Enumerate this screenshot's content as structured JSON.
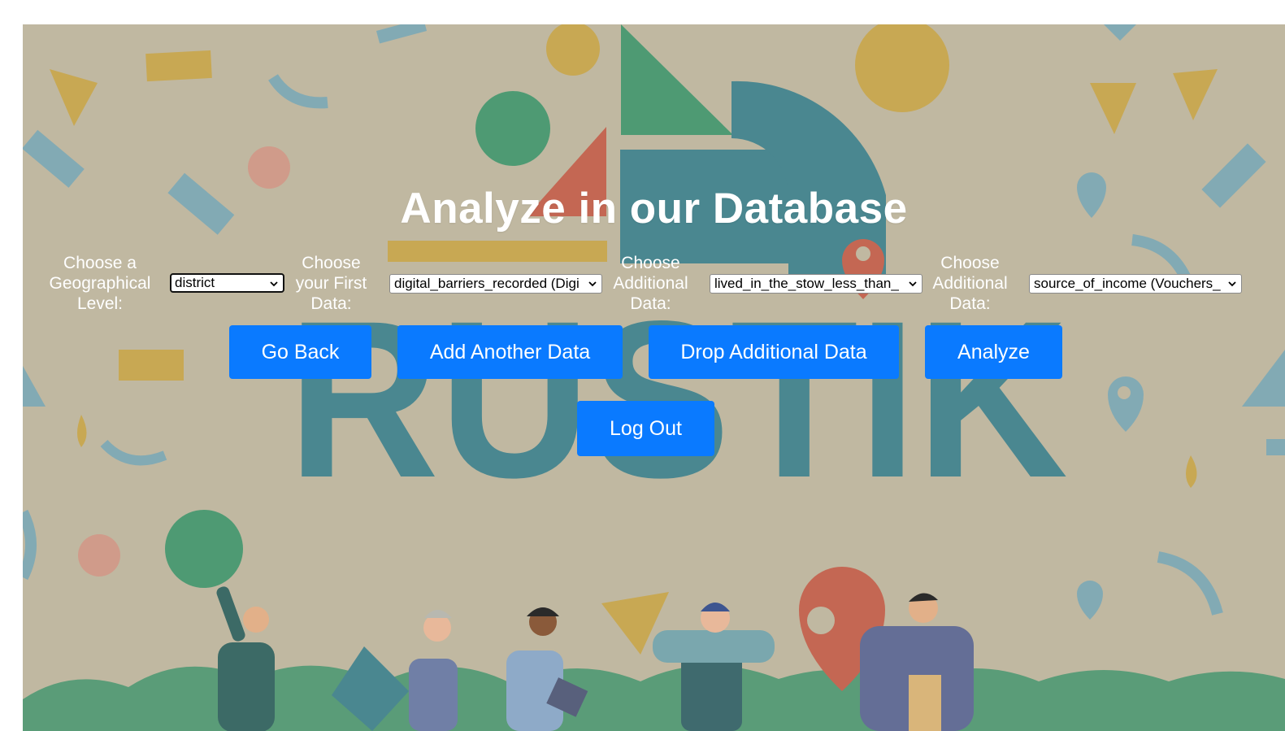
{
  "page": {
    "title": "Analyze in our Database",
    "background_logo_text": "RUSTIK"
  },
  "form": {
    "geo_label": "Choose a Geographical Level:",
    "geo_value": "district",
    "first_label": "Choose your First Data:",
    "first_value": "digital_barriers_recorded (Digi",
    "additional1_label": "Choose Additional Data:",
    "additional1_value": "lived_in_the_stow_less_than_",
    "additional2_label": "Choose Additional Data:",
    "additional2_value": "source_of_income (Vouchers_"
  },
  "buttons": {
    "go_back": "Go Back",
    "add_another": "Add Another Data",
    "drop_additional": "Drop Additional Data",
    "analyze": "Analyze",
    "log_out": "Log Out"
  },
  "colors": {
    "background": "#c0b8a1",
    "teal": "#4a8790",
    "green": "#4e9a73",
    "gold": "#c8a853",
    "coral": "#c46753",
    "button": "#0a7aff"
  }
}
